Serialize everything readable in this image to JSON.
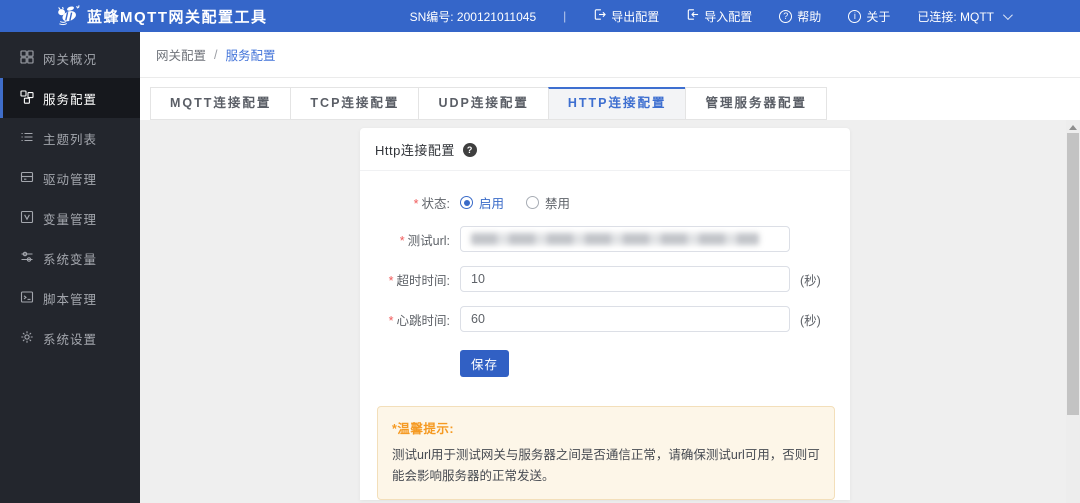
{
  "header": {
    "app_title": "蓝蜂MQTT网关配置工具",
    "sn": "SN编号: 200121011045",
    "divider": "|",
    "actions": {
      "export": "导出配置",
      "import": "导入配置",
      "help": "帮助",
      "about": "关于"
    },
    "icons": {
      "export": "export-icon",
      "import": "import-icon",
      "help_glyph": "?",
      "about_glyph": "i"
    },
    "connection": "已连接: MQTT"
  },
  "sidebar": {
    "items": [
      {
        "label": "网关概况",
        "icon": "dashboard-icon",
        "active": false
      },
      {
        "label": "服务配置",
        "icon": "service-config-icon",
        "active": true
      },
      {
        "label": "主题列表",
        "icon": "topic-list-icon",
        "active": false
      },
      {
        "label": "驱动管理",
        "icon": "driver-icon",
        "active": false
      },
      {
        "label": "变量管理",
        "icon": "variable-icon",
        "active": false
      },
      {
        "label": "系统变量",
        "icon": "system-variable-icon",
        "active": false
      },
      {
        "label": "脚本管理",
        "icon": "script-icon",
        "active": false
      },
      {
        "label": "系统设置",
        "icon": "settings-icon",
        "active": false
      }
    ]
  },
  "breadcrumb": {
    "parent": "网关配置",
    "separator": "/",
    "current": "服务配置"
  },
  "tabs": {
    "items": [
      {
        "label": "MQTT连接配置",
        "active": false
      },
      {
        "label": "TCP连接配置",
        "active": false
      },
      {
        "label": "UDP连接配置",
        "active": false
      },
      {
        "label": "HTTP连接配置",
        "active": true
      },
      {
        "label": "管理服务器配置",
        "active": false
      }
    ]
  },
  "panel": {
    "title": "Http连接配置",
    "help_glyph": "?",
    "fields": {
      "status": {
        "required_mark": "*",
        "label": "状态:",
        "option_enabled": "启用",
        "option_disabled": "禁用",
        "selected": "启用"
      },
      "test_url": {
        "required_mark": "*",
        "label": "测试url:",
        "redacted": true
      },
      "timeout": {
        "required_mark": "*",
        "label": "超时时间:",
        "value": "10",
        "unit": "(秒)"
      },
      "heartbeat": {
        "required_mark": "*",
        "label": "心跳时间:",
        "value": "60",
        "unit": "(秒)"
      }
    },
    "save_label": "保存",
    "tip": {
      "title": "*温馨提示:",
      "body": "测试url用于测试网关与服务器之间是否通信正常，请确保测试url可用，否则可能会影响服务器的正常发送。"
    }
  },
  "colors": {
    "accent_blue": "#3a6bc8",
    "header_bg": "#3566c9",
    "sidebar_bg": "#23262d",
    "sidebar_active_bg": "#16181d",
    "content_bg": "#efefef",
    "tip_bg": "#fdf6e8",
    "tip_border": "#f3dfba",
    "tip_title_color": "#f59a23",
    "required_color": "#f05a5a"
  }
}
